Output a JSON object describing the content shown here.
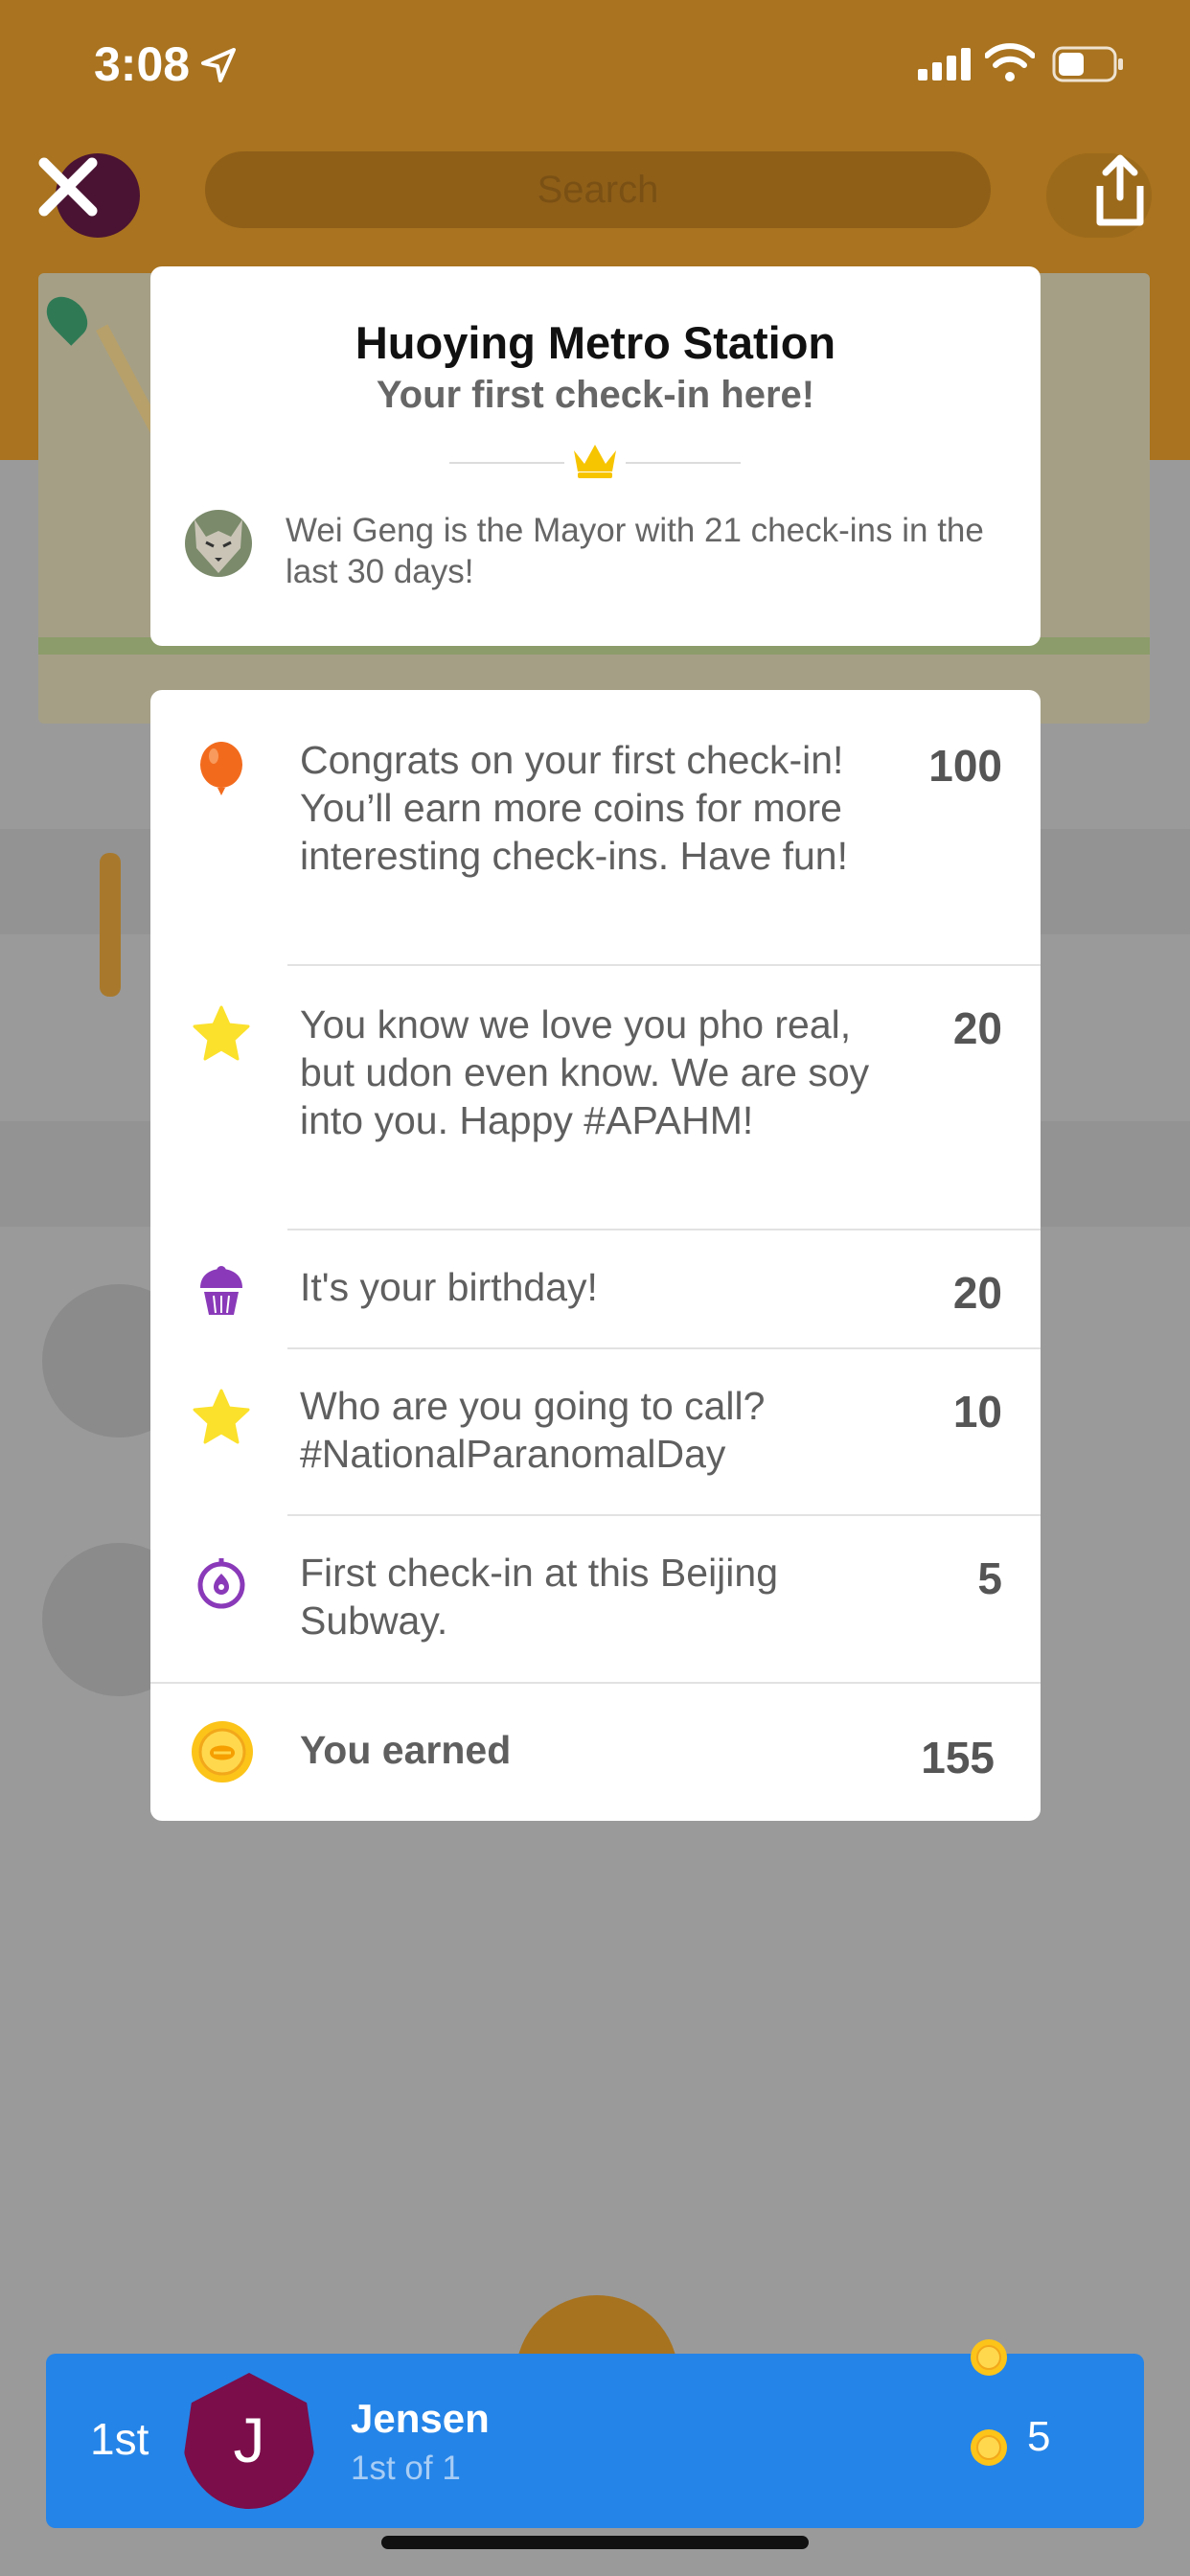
{
  "status_bar": {
    "time": "3:08"
  },
  "background": {
    "search_placeholder": "Search"
  },
  "venue": {
    "name": "Huoying Metro Station",
    "subtitle": "Your first check-in here!",
    "mayor_text": "Wei Geng is the Mayor with 21 check-ins in the last 30 days!"
  },
  "rewards": [
    {
      "icon": "balloon-icon",
      "text": "Congrats on your first check-in! You’ll earn more coins for more interesting check-ins. Have fun!",
      "points": "100"
    },
    {
      "icon": "star-icon",
      "text": "You know we love you pho real, but udon even know. We are soy into you. Happy #APAHM!",
      "points": "20"
    },
    {
      "icon": "cupcake-icon",
      "text": "It's your birthday!",
      "points": "20"
    },
    {
      "icon": "star-icon",
      "text": "Who are you going to call? #NationalParanomalDay",
      "points": "10"
    },
    {
      "icon": "compass-icon",
      "text": "First check-in at this Beijing Subway.",
      "points": "5"
    }
  ],
  "earned": {
    "label": "You earned",
    "total": "155"
  },
  "leaderboard": {
    "rank": "1st",
    "initial": "J",
    "name": "Jensen",
    "detail": "1st of 1",
    "points": "5"
  },
  "colors": {
    "header_bg": "#a9731f",
    "leader_bar": "#2584e7",
    "avatar": "#7b0d4a",
    "balloon": "#f26b1d",
    "star": "#fbe12b",
    "purple": "#8a3ab9",
    "coin": "#fcc419"
  }
}
